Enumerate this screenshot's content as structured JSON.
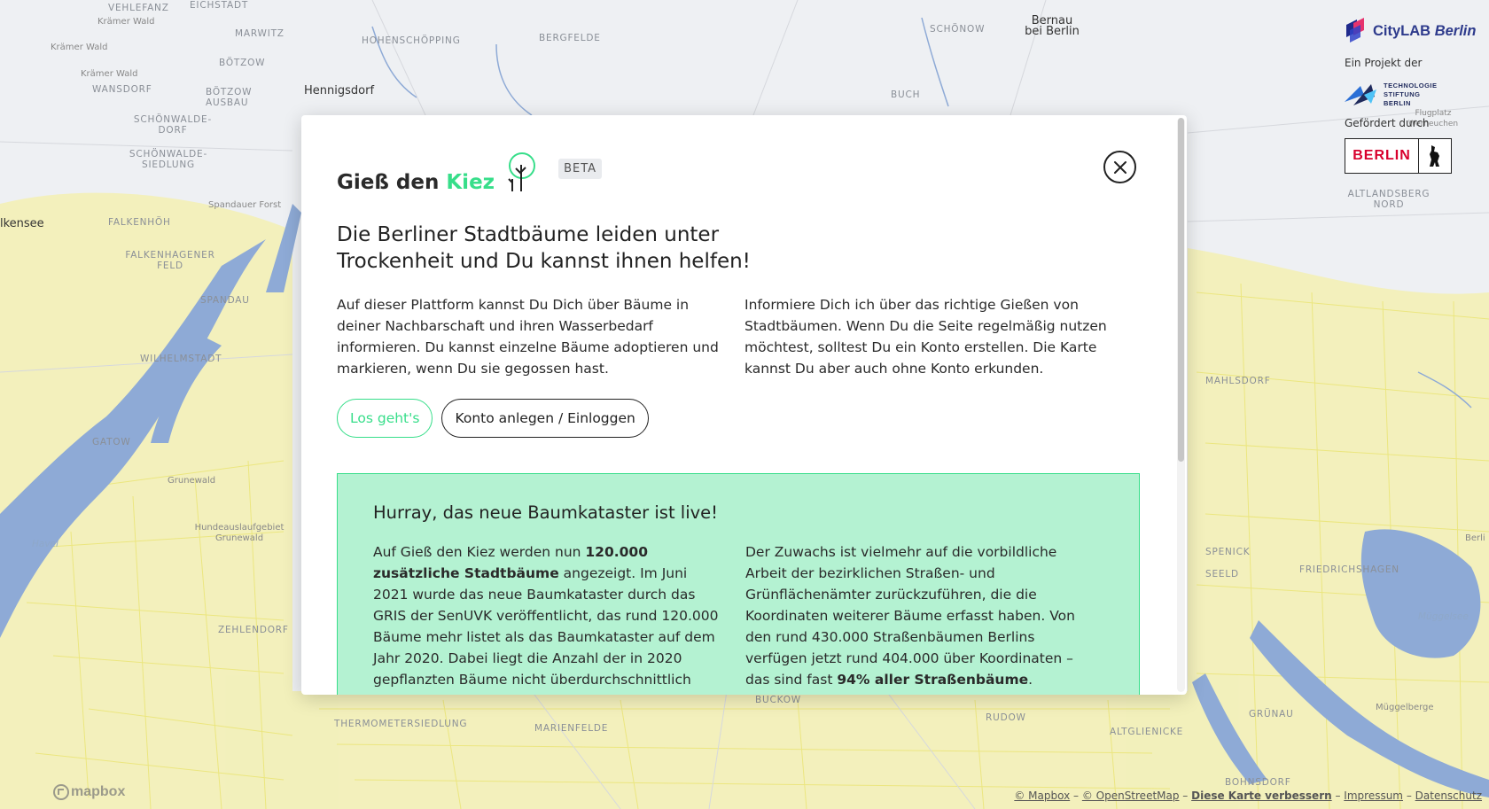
{
  "map": {
    "labels": [
      {
        "text": "VEHLEFANZ",
        "cls": ""
      },
      {
        "text": "EICHSTÄDT",
        "cls": ""
      },
      {
        "text": "Krämer Wald",
        "cls": "small"
      },
      {
        "text": "Krämer Wald",
        "cls": "small"
      },
      {
        "text": "MARWITZ",
        "cls": ""
      },
      {
        "text": "Krämer Wald",
        "cls": "small"
      },
      {
        "text": "BÖTZOW",
        "cls": ""
      },
      {
        "text": "WANSDORF",
        "cls": ""
      },
      {
        "text": "BÖTZOW AUSBAU",
        "cls": ""
      },
      {
        "text": "SCHÖNWALDE-DORF",
        "cls": ""
      },
      {
        "text": "SCHÖNWALDE-SIEDLUNG",
        "cls": ""
      },
      {
        "text": "HOHENSCHÖPPING",
        "cls": ""
      },
      {
        "text": "BERGFELDE",
        "cls": ""
      },
      {
        "text": "SCHÖNOW",
        "cls": ""
      },
      {
        "text": "Bernau bei Berlin",
        "cls": "city"
      },
      {
        "text": "Hennigsdorf",
        "cls": "city"
      },
      {
        "text": "BUCH",
        "cls": ""
      },
      {
        "text": "Spandauer Forst",
        "cls": "small"
      },
      {
        "text": "FALKENHÖH",
        "cls": ""
      },
      {
        "text": "lkensee",
        "cls": "city"
      },
      {
        "text": "FALKENHAGENER FELD",
        "cls": ""
      },
      {
        "text": "SPANDAU",
        "cls": ""
      },
      {
        "text": "WILHELMSTADT",
        "cls": ""
      },
      {
        "text": "GATOW",
        "cls": ""
      },
      {
        "text": "Grunewald",
        "cls": "small"
      },
      {
        "text": "Hundeauslaufgebiet Grunewald",
        "cls": "small"
      },
      {
        "text": "Havel",
        "cls": "water"
      },
      {
        "text": "ZEHLENDORF",
        "cls": ""
      },
      {
        "text": "THERMOMETERSIEDLUNG",
        "cls": ""
      },
      {
        "text": "MARIENFELDE",
        "cls": ""
      },
      {
        "text": "BUCKOW",
        "cls": ""
      },
      {
        "text": "RUDOW",
        "cls": ""
      },
      {
        "text": "ALTGLIENICKE",
        "cls": ""
      },
      {
        "text": "GRÜNAU",
        "cls": ""
      },
      {
        "text": "Müggelberge",
        "cls": "small"
      },
      {
        "text": "BOHNSDORF",
        "cls": ""
      },
      {
        "text": "Müggelsee",
        "cls": "water"
      },
      {
        "text": "FRIEDRICHSHAGEN",
        "cls": ""
      },
      {
        "text": "SPENICK",
        "cls": ""
      },
      {
        "text": "Berli",
        "cls": "small"
      },
      {
        "text": "MAHLSDORF",
        "cls": ""
      },
      {
        "text": "ALTLANDSBERG NORD",
        "cls": ""
      },
      {
        "text": "Flugplatz Werneuchen",
        "cls": "small"
      },
      {
        "text": "SEELD",
        "cls": ""
      }
    ]
  },
  "sponsors": {
    "citylab_name": "CityLAB",
    "citylab_city": "Berlin",
    "project_caption": "Ein Projekt der",
    "tsb_lines": [
      "TECHNOLOGIE",
      "STIFTUNG",
      "BERLIN"
    ],
    "funded_caption": "Gefördert durch",
    "berlin_logo_text": "BERLIN"
  },
  "modal": {
    "brand_prefix": "Gieß den ",
    "brand_accent": "Kiez",
    "beta": "BETA",
    "headline": "Die Berliner Stadtbäume leiden unter Trockenheit und Du kannst ihnen helfen!",
    "intro_left": "Auf dieser Plattform kannst Du Dich über Bäume in deiner Nachbarschaft und ihren Wasserbedarf informieren. Du kannst einzelne Bäume adoptieren und markieren, wenn Du sie gegossen hast.",
    "intro_right": "Informiere Dich ich über das richtige Gießen von Stadtbäumen. Wenn Du die Seite regelmäßig nutzen möchtest, solltest Du ein Konto erstellen. Die Karte kannst Du aber auch ohne Konto erkunden.",
    "primary_button": "Los geht's",
    "secondary_button": "Konto anlegen / Einloggen",
    "news": {
      "title": "Hurray, das neue Baumkataster ist live!",
      "left_a": "Auf Gieß den Kiez werden nun ",
      "left_bold": "120.000 zusätzliche Stadtbäume",
      "left_b": " angezeigt. Im Juni 2021 wurde das neue Baumkataster durch das GRIS der SenUVK veröffentlicht, das rund 120.000 Bäume mehr listet als das Baumkataster auf dem Jahr 2020. Dabei liegt die Anzahl der in 2020 gepflanzten Bäume nicht überdurchschnittlich hoch.",
      "right_a": "Der Zuwachs ist vielmehr auf die vorbildliche Arbeit der bezirklichen Straßen- und Grünflächenämter zurückzuführen, die die Koordinaten weiterer Bäume erfasst haben. Von den rund 430.000 Straßenbäumen Berlins verfügen jetzt rund 404.000 über Koordinaten – das sind fast ",
      "right_bold": "94% aller Straßenbäume",
      "right_b": "."
    }
  },
  "attribution": {
    "mapbox": "© Mapbox",
    "osm": "© OpenStreetMap",
    "improve": "Diese Karte verbessern",
    "impressum": "Impressum",
    "datenschutz": "Datenschutz",
    "sep": " – "
  },
  "mapbox_logo": "mapbox",
  "colors": {
    "accent": "#37de8a",
    "news_bg": "#b4f2d2",
    "water": "#8eaad6",
    "trees": "#e8e36a"
  }
}
